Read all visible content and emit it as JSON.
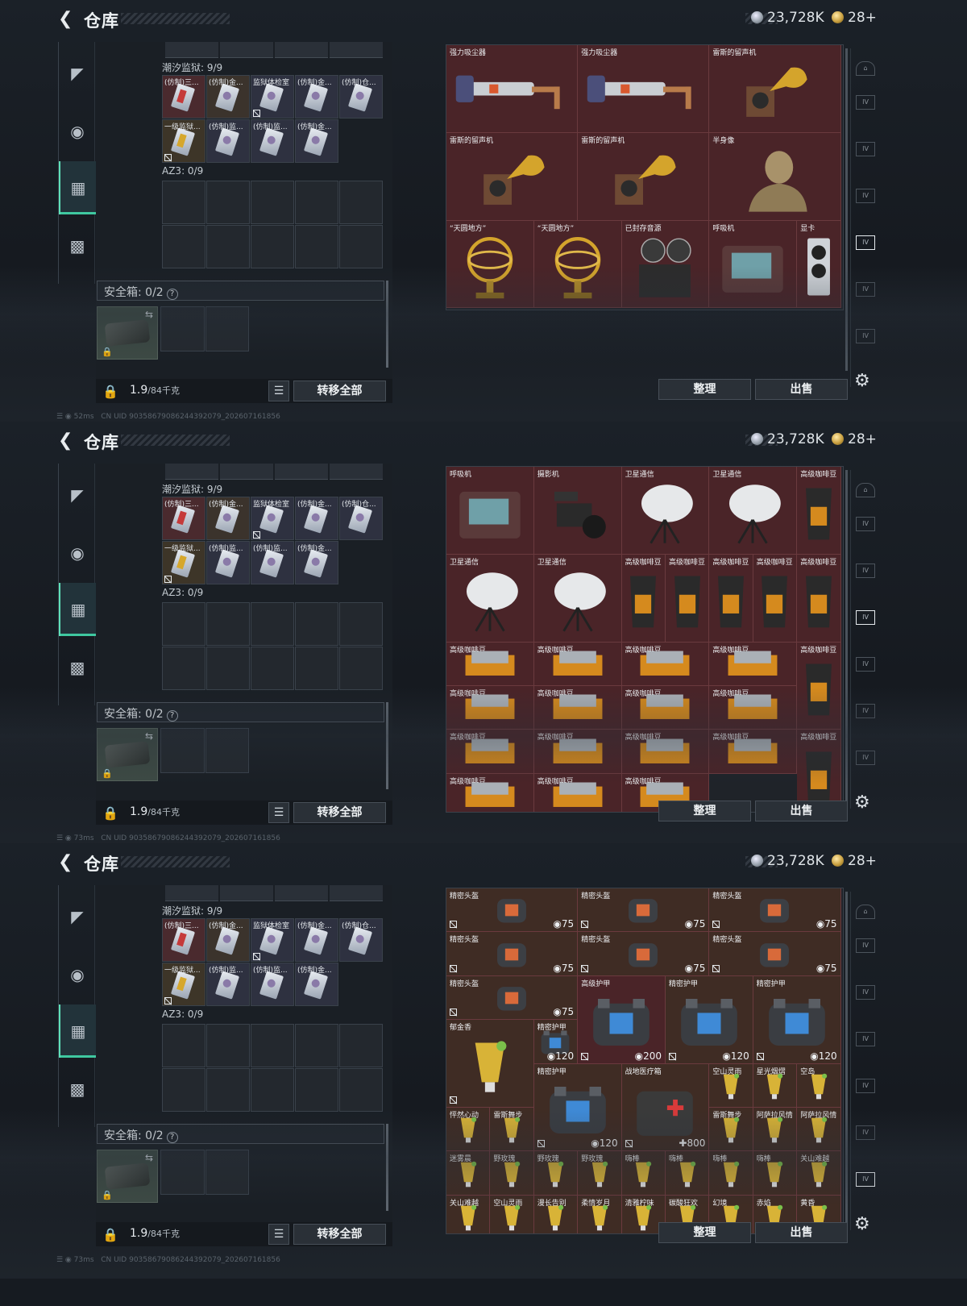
{
  "header": {
    "title": "仓库",
    "silver": "23,728K",
    "gold": "28+"
  },
  "status": {
    "uid": "CN UID 903586790862443920​79_202607161856",
    "ping": [
      "52ms",
      "73ms",
      "73ms"
    ]
  },
  "left": {
    "top_label": "潮汐监狱: 9/9",
    "az3_label": "AZ3: 0/9",
    "safe_label": "安全箱: 0/2",
    "weight_value": "1.9",
    "weight_unit": "/84千克",
    "transfer_label": "转移全部",
    "cards_row1": [
      "(仿制)三...",
      "(仿制)金...",
      "监狱体检室",
      "(仿制)金...",
      "(仿制)仓..."
    ],
    "cards_row2": [
      "一级监狱...",
      "(仿制)监...",
      "(仿制)监...",
      "(仿制)金..."
    ]
  },
  "buttons": {
    "sort": "整理",
    "sell": "出售"
  },
  "panels": [
    {
      "items": [
        {
          "name": "强力吸尘器",
          "icon": "vacuum-icon"
        },
        {
          "name": "强力吸尘器",
          "icon": "vacuum-icon"
        },
        {
          "name": "雷斯的留声机",
          "icon": "gramophone-icon"
        },
        {
          "name": "雷斯的留声机",
          "icon": "gramophone-icon"
        },
        {
          "name": "雷斯的留声机",
          "icon": "gramophone-icon"
        },
        {
          "name": "半身像",
          "icon": "bust-icon"
        },
        {
          "name": "“天圆地方”",
          "icon": "armillary-icon"
        },
        {
          "name": "“天圆地方”",
          "icon": "armillary-icon"
        },
        {
          "name": "已封存音源",
          "icon": "reel-recorder-icon"
        },
        {
          "name": "呼吸机",
          "icon": "ventilator-icon"
        },
        {
          "name": "显卡",
          "icon": "gpu-icon"
        }
      ]
    },
    {
      "items": [
        {
          "name": "呼吸机",
          "icon": "ventilator-icon"
        },
        {
          "name": "摄影机",
          "icon": "camera-icon"
        },
        {
          "name": "卫星通信",
          "icon": "satellite-dish-icon"
        },
        {
          "name": "卫星通信",
          "icon": "satellite-dish-icon"
        },
        {
          "name": "高级咖啡豆",
          "icon": "coffee-bag-icon"
        },
        {
          "name": "卫星通信",
          "icon": "satellite-dish-icon"
        },
        {
          "name": "卫星通信",
          "icon": "satellite-dish-icon"
        },
        {
          "name": "高级咖啡豆",
          "icon": "coffee-bag-icon"
        },
        {
          "name": "高级咖啡豆",
          "icon": "coffee-bag-icon"
        },
        {
          "name": "高级咖啡豆",
          "icon": "coffee-bag-icon"
        },
        {
          "name": "高级咖啡豆",
          "icon": "coffee-bag-icon"
        },
        {
          "name": "高级咖啡豆",
          "icon": "coffee-bag-icon"
        },
        {
          "name": "高级咖啡豆",
          "icon": "coffee-box-icon"
        },
        {
          "name": "高级咖啡豆",
          "icon": "coffee-box-icon"
        },
        {
          "name": "高级咖啡豆",
          "icon": "coffee-box-icon"
        },
        {
          "name": "高级咖啡豆",
          "icon": "coffee-box-icon"
        },
        {
          "name": "高级咖啡豆",
          "icon": "coffee-bag-icon"
        },
        {
          "name": "高级咖啡豆",
          "icon": "coffee-box-icon"
        },
        {
          "name": "高级咖啡豆",
          "icon": "coffee-box-icon"
        },
        {
          "name": "高级咖啡豆",
          "icon": "coffee-box-icon"
        },
        {
          "name": "高级咖啡豆",
          "icon": "coffee-box-icon"
        },
        {
          "name": "高级咖啡豆",
          "icon": "coffee-box-icon"
        },
        {
          "name": "高级咖啡豆",
          "icon": "coffee-box-icon"
        },
        {
          "name": "高级咖啡豆",
          "icon": "coffee-box-icon"
        },
        {
          "name": "高级咖啡豆",
          "icon": "coffee-box-icon"
        },
        {
          "name": "高级咖啡豆",
          "icon": "coffee-bag-icon"
        },
        {
          "name": "高级咖啡豆",
          "icon": "coffee-box-icon"
        },
        {
          "name": "高级咖啡豆",
          "icon": "coffee-box-icon"
        },
        {
          "name": "高级咖啡豆",
          "icon": "coffee-box-icon"
        }
      ]
    },
    {
      "items": [
        {
          "name": "精密头盔",
          "icon": "helmet-icon",
          "value": "75"
        },
        {
          "name": "精密头盔",
          "icon": "helmet-icon",
          "value": "75"
        },
        {
          "name": "精密头盔",
          "icon": "helmet-icon",
          "value": "75"
        },
        {
          "name": "精密头盔",
          "icon": "helmet-icon",
          "value": "75"
        },
        {
          "name": "精密头盔",
          "icon": "helmet-icon",
          "value": "75"
        },
        {
          "name": "精密头盔",
          "icon": "helmet-icon",
          "value": "75"
        },
        {
          "name": "精密头盔",
          "icon": "helmet-icon",
          "value": "75"
        },
        {
          "name": "高级护甲",
          "icon": "armor-icon",
          "value": "200"
        },
        {
          "name": "精密护甲",
          "icon": "armor-icon",
          "value": "120"
        },
        {
          "name": "精密护甲",
          "icon": "armor-icon",
          "value": "120"
        },
        {
          "name": "精密护甲",
          "icon": "armor-icon",
          "value": "120"
        },
        {
          "name": "郁金香",
          "icon": "cocktail-icon"
        },
        {
          "name": "精密护甲",
          "icon": "armor-icon",
          "value": "120"
        },
        {
          "name": "战地医疗箱",
          "icon": "medkit-icon",
          "value": "800"
        },
        {
          "name": "空山灵雨",
          "icon": "cocktail-icon"
        },
        {
          "name": "星光烟熠",
          "icon": "cocktail-icon"
        },
        {
          "name": "空岛",
          "icon": "cocktail-icon"
        },
        {
          "name": "怦然心动",
          "icon": "cocktail-icon"
        },
        {
          "name": "雷斯舞步",
          "icon": "cocktail-icon"
        },
        {
          "name": "雷斯舞步",
          "icon": "cocktail-icon"
        },
        {
          "name": "阿萨拉风情",
          "icon": "cocktail-icon"
        },
        {
          "name": "阿萨拉风情",
          "icon": "cocktail-icon"
        },
        {
          "name": "迷雾晨",
          "icon": "cocktail-icon"
        },
        {
          "name": "野玫瑰",
          "icon": "cocktail-icon"
        },
        {
          "name": "野玫瑰",
          "icon": "cocktail-icon"
        },
        {
          "name": "野玫瑰",
          "icon": "cocktail-icon"
        },
        {
          "name": "嗨棒",
          "icon": "cocktail-icon"
        },
        {
          "name": "嗨棒",
          "icon": "cocktail-icon"
        },
        {
          "name": "嗨棒",
          "icon": "cocktail-icon"
        },
        {
          "name": "嗨棒",
          "icon": "cocktail-icon"
        },
        {
          "name": "关山难越",
          "icon": "cocktail-icon"
        },
        {
          "name": "关山难越",
          "icon": "cocktail-icon"
        },
        {
          "name": "空山灵雨",
          "icon": "cocktail-icon"
        },
        {
          "name": "漫长告别",
          "icon": "cocktail-icon"
        },
        {
          "name": "柔情岁月",
          "icon": "cocktail-icon"
        },
        {
          "name": "清雅柠味",
          "icon": "cocktail-icon"
        },
        {
          "name": "碳酸狂欢",
          "icon": "cocktail-icon"
        },
        {
          "name": "幻境",
          "icon": "cocktail-icon"
        },
        {
          "name": "赤焰",
          "icon": "cocktail-icon"
        },
        {
          "name": "黄昏",
          "icon": "cocktail-icon"
        }
      ]
    }
  ]
}
